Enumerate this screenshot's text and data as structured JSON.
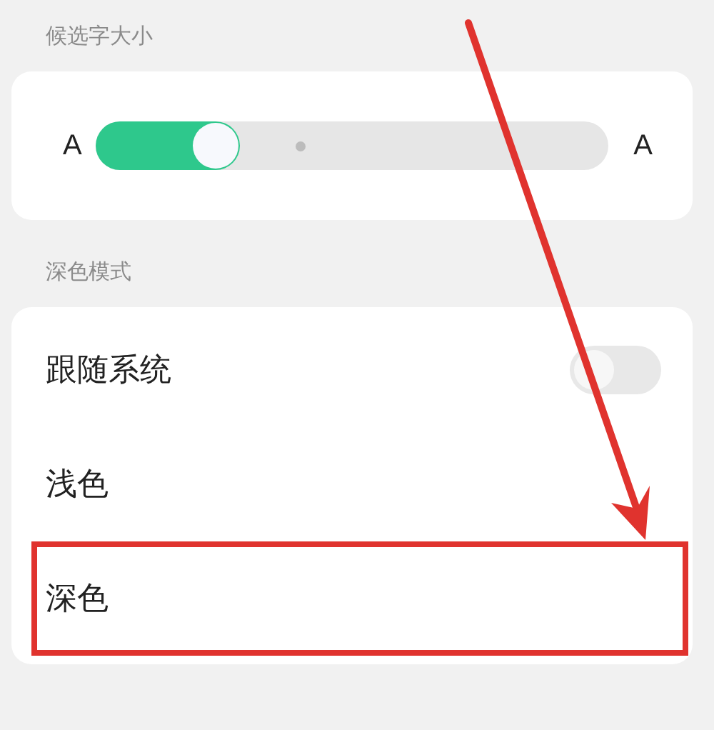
{
  "font_size": {
    "title": "候选字大小",
    "small_label": "A",
    "large_label": "A",
    "level": 0.28
  },
  "dark_mode": {
    "title": "深色模式",
    "options": [
      {
        "label": "跟随系统",
        "kind": "toggle",
        "on": false,
        "highlighted": false
      },
      {
        "label": "浅色",
        "kind": "plain",
        "highlighted": false
      },
      {
        "label": "深色",
        "kind": "plain",
        "highlighted": true
      }
    ]
  }
}
